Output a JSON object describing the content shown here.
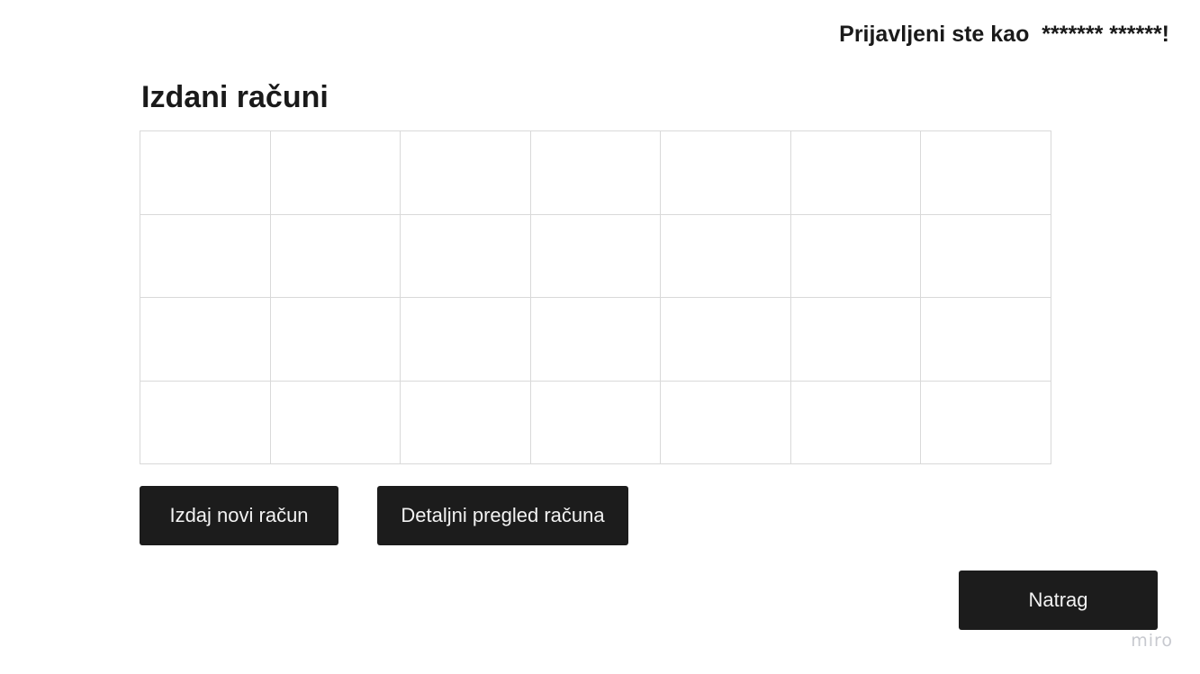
{
  "header": {
    "greeting": "Prijavljeni ste kao  ******* ******!"
  },
  "page": {
    "title": "Izdani računi"
  },
  "table": {
    "rows": [
      [
        "",
        "",
        "",
        "",
        "",
        "",
        ""
      ],
      [
        "",
        "",
        "",
        "",
        "",
        "",
        ""
      ],
      [
        "",
        "",
        "",
        "",
        "",
        "",
        ""
      ],
      [
        "",
        "",
        "",
        "",
        "",
        "",
        ""
      ]
    ]
  },
  "actions": {
    "new_invoice_label": "Izdaj novi račun",
    "detail_view_label": "Detaljni pregled računa",
    "back_label": "Natrag"
  },
  "watermark": {
    "text": "miro"
  },
  "colors": {
    "button_background": "#1c1c1c",
    "button_text": "#f2f2f2",
    "grid_line": "#d9d9d9",
    "watermark": "#c7c9cf"
  }
}
